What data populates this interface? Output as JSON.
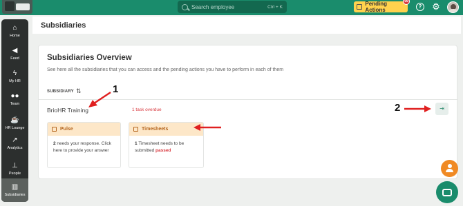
{
  "topbar": {
    "search_placeholder": "Search employee",
    "search_shortcut": "Ctrl + K",
    "pending_label": "Pending Actions",
    "pending_count": "99"
  },
  "sidebar": {
    "items": [
      {
        "label": "Home",
        "icon": "home-icon"
      },
      {
        "label": "Feed",
        "icon": "megaphone-icon"
      },
      {
        "label": "My HR",
        "icon": "bolt-icon"
      },
      {
        "label": "Team",
        "icon": "team-icon"
      },
      {
        "label": "HR Lounge",
        "icon": "coffee-icon"
      },
      {
        "label": "Analytics",
        "icon": "chart-icon"
      },
      {
        "label": "People",
        "icon": "org-chart-icon"
      },
      {
        "label": "Subsidiaries",
        "icon": "building-icon"
      }
    ],
    "active": "Subsidiaries"
  },
  "header": {
    "title": "Subsidiaries"
  },
  "overview": {
    "title": "Subsidiaries Overview",
    "subtitle": "See here all the subsidiaries that you can access and the pending actions you have to perform in each of them",
    "column_header": "SUBSIDIARY",
    "subsidiary": {
      "name": "BrioHR Training",
      "overdue": "1 task overdue"
    },
    "tiles": [
      {
        "title": "Pulse",
        "count": "2",
        "text": " needs your response. Click here to provide your answer"
      },
      {
        "title": "Timesheets",
        "count": "1",
        "text": " Timesheet needs to be submitted ",
        "status": "passed"
      }
    ]
  },
  "annotations": {
    "one": "1",
    "two": "2"
  },
  "colors": {
    "brand": "#1a8c6c",
    "pending": "#ffd24d",
    "overdue": "#d9393f",
    "arrow": "#e02020",
    "fab": "#f08a24"
  }
}
